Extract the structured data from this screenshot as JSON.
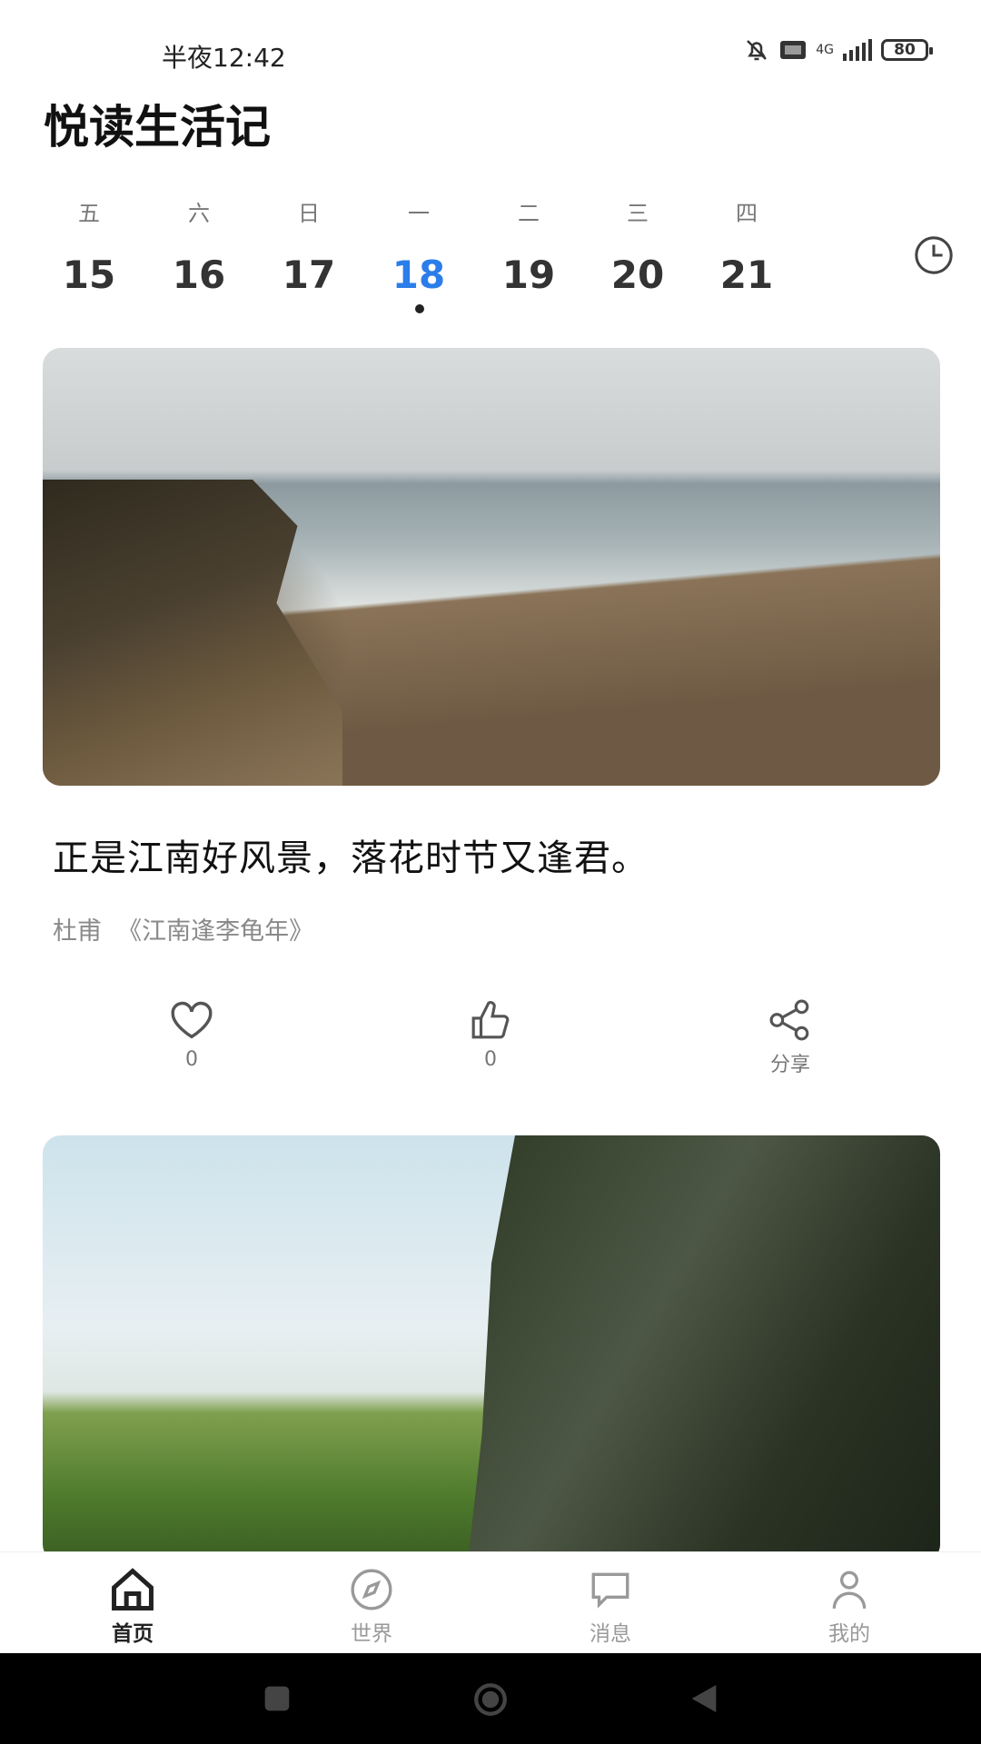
{
  "status_bar": {
    "time": "半夜12:42",
    "network": "4G",
    "battery": "80"
  },
  "app_title": "悦读生活记",
  "week": {
    "days": [
      {
        "weekday": "五",
        "date": "15"
      },
      {
        "weekday": "六",
        "date": "16"
      },
      {
        "weekday": "日",
        "date": "17"
      },
      {
        "weekday": "一",
        "date": "18"
      },
      {
        "weekday": "二",
        "date": "19"
      },
      {
        "weekday": "三",
        "date": "20"
      },
      {
        "weekday": "四",
        "date": "21"
      }
    ],
    "selected_index": 3,
    "selected_color": "#2b7de9"
  },
  "quote": {
    "text": "正是江南好风景，落花时节又逢君。",
    "source": "杜甫  《江南逢李龟年》"
  },
  "actions": {
    "favorite_count": "0",
    "like_count": "0",
    "share_label": "分享"
  },
  "nav": {
    "items": [
      {
        "label": "首页",
        "icon": "home-icon"
      },
      {
        "label": "世界",
        "icon": "compass-icon"
      },
      {
        "label": "消息",
        "icon": "chat-icon"
      },
      {
        "label": "我的",
        "icon": "user-icon"
      }
    ],
    "active_index": 0
  }
}
